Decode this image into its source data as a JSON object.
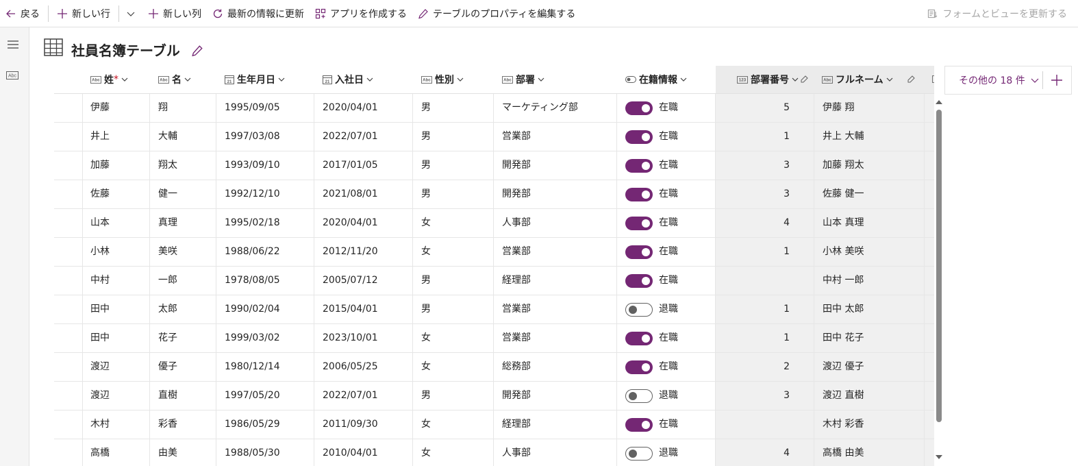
{
  "toolbar": {
    "back": "戻る",
    "new_row": "新しい行",
    "new_column": "新しい列",
    "refresh": "最新の情報に更新",
    "create_app": "アプリを作成する",
    "edit_props": "テーブルのプロパティを編集する",
    "update_forms": "フォームとビューを更新する"
  },
  "page": {
    "title": "社員名簿テーブル"
  },
  "columns": {
    "last_name": "姓",
    "required_mark": "*",
    "first_name": "名",
    "birth_date": "生年月日",
    "hire_date": "入社日",
    "gender": "性別",
    "department": "部署",
    "status": "在籍情報",
    "dept_no": "部署番号",
    "full_name": "フルネーム"
  },
  "more_columns": {
    "label": "その他の 18 件"
  },
  "rows": [
    {
      "last": "伊藤",
      "first": "翔",
      "birth": "1995/09/05",
      "hire": "2020/04/01",
      "gender": "男",
      "dept": "マーケティング部",
      "status_on": true,
      "status": "在職",
      "dept_no": "5",
      "full": "伊藤 翔"
    },
    {
      "last": "井上",
      "first": "大輔",
      "birth": "1997/03/08",
      "hire": "2022/07/01",
      "gender": "男",
      "dept": "営業部",
      "status_on": true,
      "status": "在職",
      "dept_no": "1",
      "full": "井上 大輔"
    },
    {
      "last": "加藤",
      "first": "翔太",
      "birth": "1993/09/10",
      "hire": "2017/01/05",
      "gender": "男",
      "dept": "開発部",
      "status_on": true,
      "status": "在職",
      "dept_no": "3",
      "full": "加藤 翔太"
    },
    {
      "last": "佐藤",
      "first": "健一",
      "birth": "1992/12/10",
      "hire": "2021/08/01",
      "gender": "男",
      "dept": "開発部",
      "status_on": true,
      "status": "在職",
      "dept_no": "3",
      "full": "佐藤 健一"
    },
    {
      "last": "山本",
      "first": "真理",
      "birth": "1995/02/18",
      "hire": "2020/04/01",
      "gender": "女",
      "dept": "人事部",
      "status_on": true,
      "status": "在職",
      "dept_no": "4",
      "full": "山本 真理"
    },
    {
      "last": "小林",
      "first": "美咲",
      "birth": "1988/06/22",
      "hire": "2012/11/20",
      "gender": "女",
      "dept": "営業部",
      "status_on": true,
      "status": "在職",
      "dept_no": "1",
      "full": "小林 美咲"
    },
    {
      "last": "中村",
      "first": "一郎",
      "birth": "1978/08/05",
      "hire": "2005/07/12",
      "gender": "男",
      "dept": "経理部",
      "status_on": true,
      "status": "在職",
      "dept_no": "",
      "full": "中村 一郎"
    },
    {
      "last": "田中",
      "first": "太郎",
      "birth": "1990/02/04",
      "hire": "2015/04/01",
      "gender": "男",
      "dept": "営業部",
      "status_on": false,
      "status": "退職",
      "dept_no": "1",
      "full": "田中 太郎"
    },
    {
      "last": "田中",
      "first": "花子",
      "birth": "1999/03/02",
      "hire": "2023/10/01",
      "gender": "女",
      "dept": "営業部",
      "status_on": true,
      "status": "在職",
      "dept_no": "1",
      "full": "田中 花子"
    },
    {
      "last": "渡辺",
      "first": "優子",
      "birth": "1980/12/14",
      "hire": "2006/05/25",
      "gender": "女",
      "dept": "総務部",
      "status_on": true,
      "status": "在職",
      "dept_no": "2",
      "full": "渡辺 優子"
    },
    {
      "last": "渡辺",
      "first": "直樹",
      "birth": "1997/05/20",
      "hire": "2022/07/01",
      "gender": "男",
      "dept": "開発部",
      "status_on": false,
      "status": "退職",
      "dept_no": "3",
      "full": "渡辺 直樹"
    },
    {
      "last": "木村",
      "first": "彩香",
      "birth": "1986/05/29",
      "hire": "2011/09/30",
      "gender": "女",
      "dept": "経理部",
      "status_on": true,
      "status": "在職",
      "dept_no": "",
      "full": "木村 彩香"
    },
    {
      "last": "高橋",
      "first": "由美",
      "birth": "1988/05/30",
      "hire": "2010/04/01",
      "gender": "女",
      "dept": "人事部",
      "status_on": false,
      "status": "退職",
      "dept_no": "4",
      "full": "高橋 由美"
    }
  ],
  "colors": {
    "accent": "#742774",
    "toggle_on": "#742774",
    "required": "#c50f1f"
  }
}
